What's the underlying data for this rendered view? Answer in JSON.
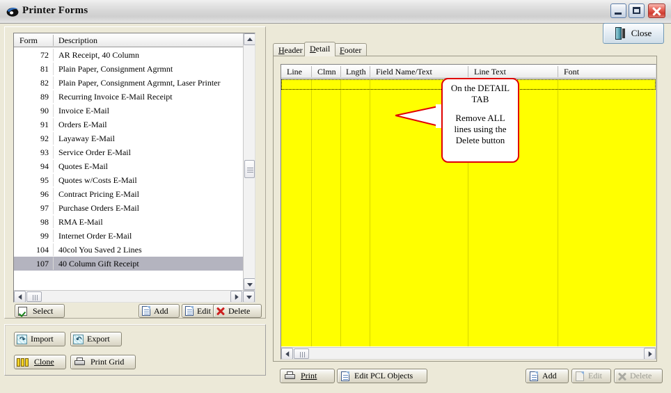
{
  "window": {
    "title": "Printer Forms",
    "icon": "app-swoosh-icon",
    "minimize_label": "Minimize",
    "maximize_label": "Maximize",
    "close_label": "Close"
  },
  "close_button": {
    "label": "Close",
    "icon": "exit-door-icon"
  },
  "form_list": {
    "columns": [
      "Form",
      "Description"
    ],
    "rows": [
      {
        "form": "72",
        "description": "AR Receipt, 40 Column"
      },
      {
        "form": "81",
        "description": "Plain Paper, Consignment Agrmnt"
      },
      {
        "form": "82",
        "description": "Plain Paper, Consignment Agrmnt, Laser Printer"
      },
      {
        "form": "89",
        "description": "Recurring Invoice E-Mail Receipt"
      },
      {
        "form": "90",
        "description": "Invoice E-Mail"
      },
      {
        "form": "91",
        "description": "Orders E-Mail"
      },
      {
        "form": "92",
        "description": "Layaway E-Mail"
      },
      {
        "form": "93",
        "description": "Service Order E-Mail"
      },
      {
        "form": "94",
        "description": "Quotes E-Mail"
      },
      {
        "form": "95",
        "description": "Quotes w/Costs E-Mail"
      },
      {
        "form": "96",
        "description": "Contract Pricing E-Mail"
      },
      {
        "form": "97",
        "description": "Purchase Orders E-Mail"
      },
      {
        "form": "98",
        "description": "RMA E-Mail"
      },
      {
        "form": "99",
        "description": "Internet Order E-Mail"
      },
      {
        "form": "104",
        "description": "40col You Saved 2 Lines"
      },
      {
        "form": "107",
        "description": "40 Column Gift Receipt"
      }
    ],
    "selected_index": 15
  },
  "list_buttons": {
    "select": "Select",
    "add": "Add",
    "edit": "Edit",
    "delete": "Delete"
  },
  "tools_panel": {
    "import": "Import",
    "export": "Export",
    "clone": "Clone",
    "print_grid": "Print Grid"
  },
  "tabs": [
    {
      "label": "Header",
      "mnemonic": "H",
      "active": false
    },
    {
      "label": "Detail",
      "mnemonic": "D",
      "active": true
    },
    {
      "label": "Footer",
      "mnemonic": "F",
      "active": false
    }
  ],
  "detail_grid": {
    "columns": [
      "Line",
      "Clmn",
      "Lngth",
      "Field Name/Text",
      "Line Text",
      "Font"
    ],
    "rows": [],
    "row_background": "#ffff00"
  },
  "detail_buttons": {
    "print": "Print",
    "edit_pcl_objects": "Edit PCL Objects",
    "add": "Add",
    "edit": "Edit",
    "delete": "Delete",
    "edit_enabled": false,
    "delete_enabled": false
  },
  "callout": {
    "line1": "On the DETAIL",
    "line2": "TAB",
    "line3": "Remove ALL",
    "line4": "lines using the",
    "line5": "Delete button",
    "border_color": "#e00000"
  }
}
